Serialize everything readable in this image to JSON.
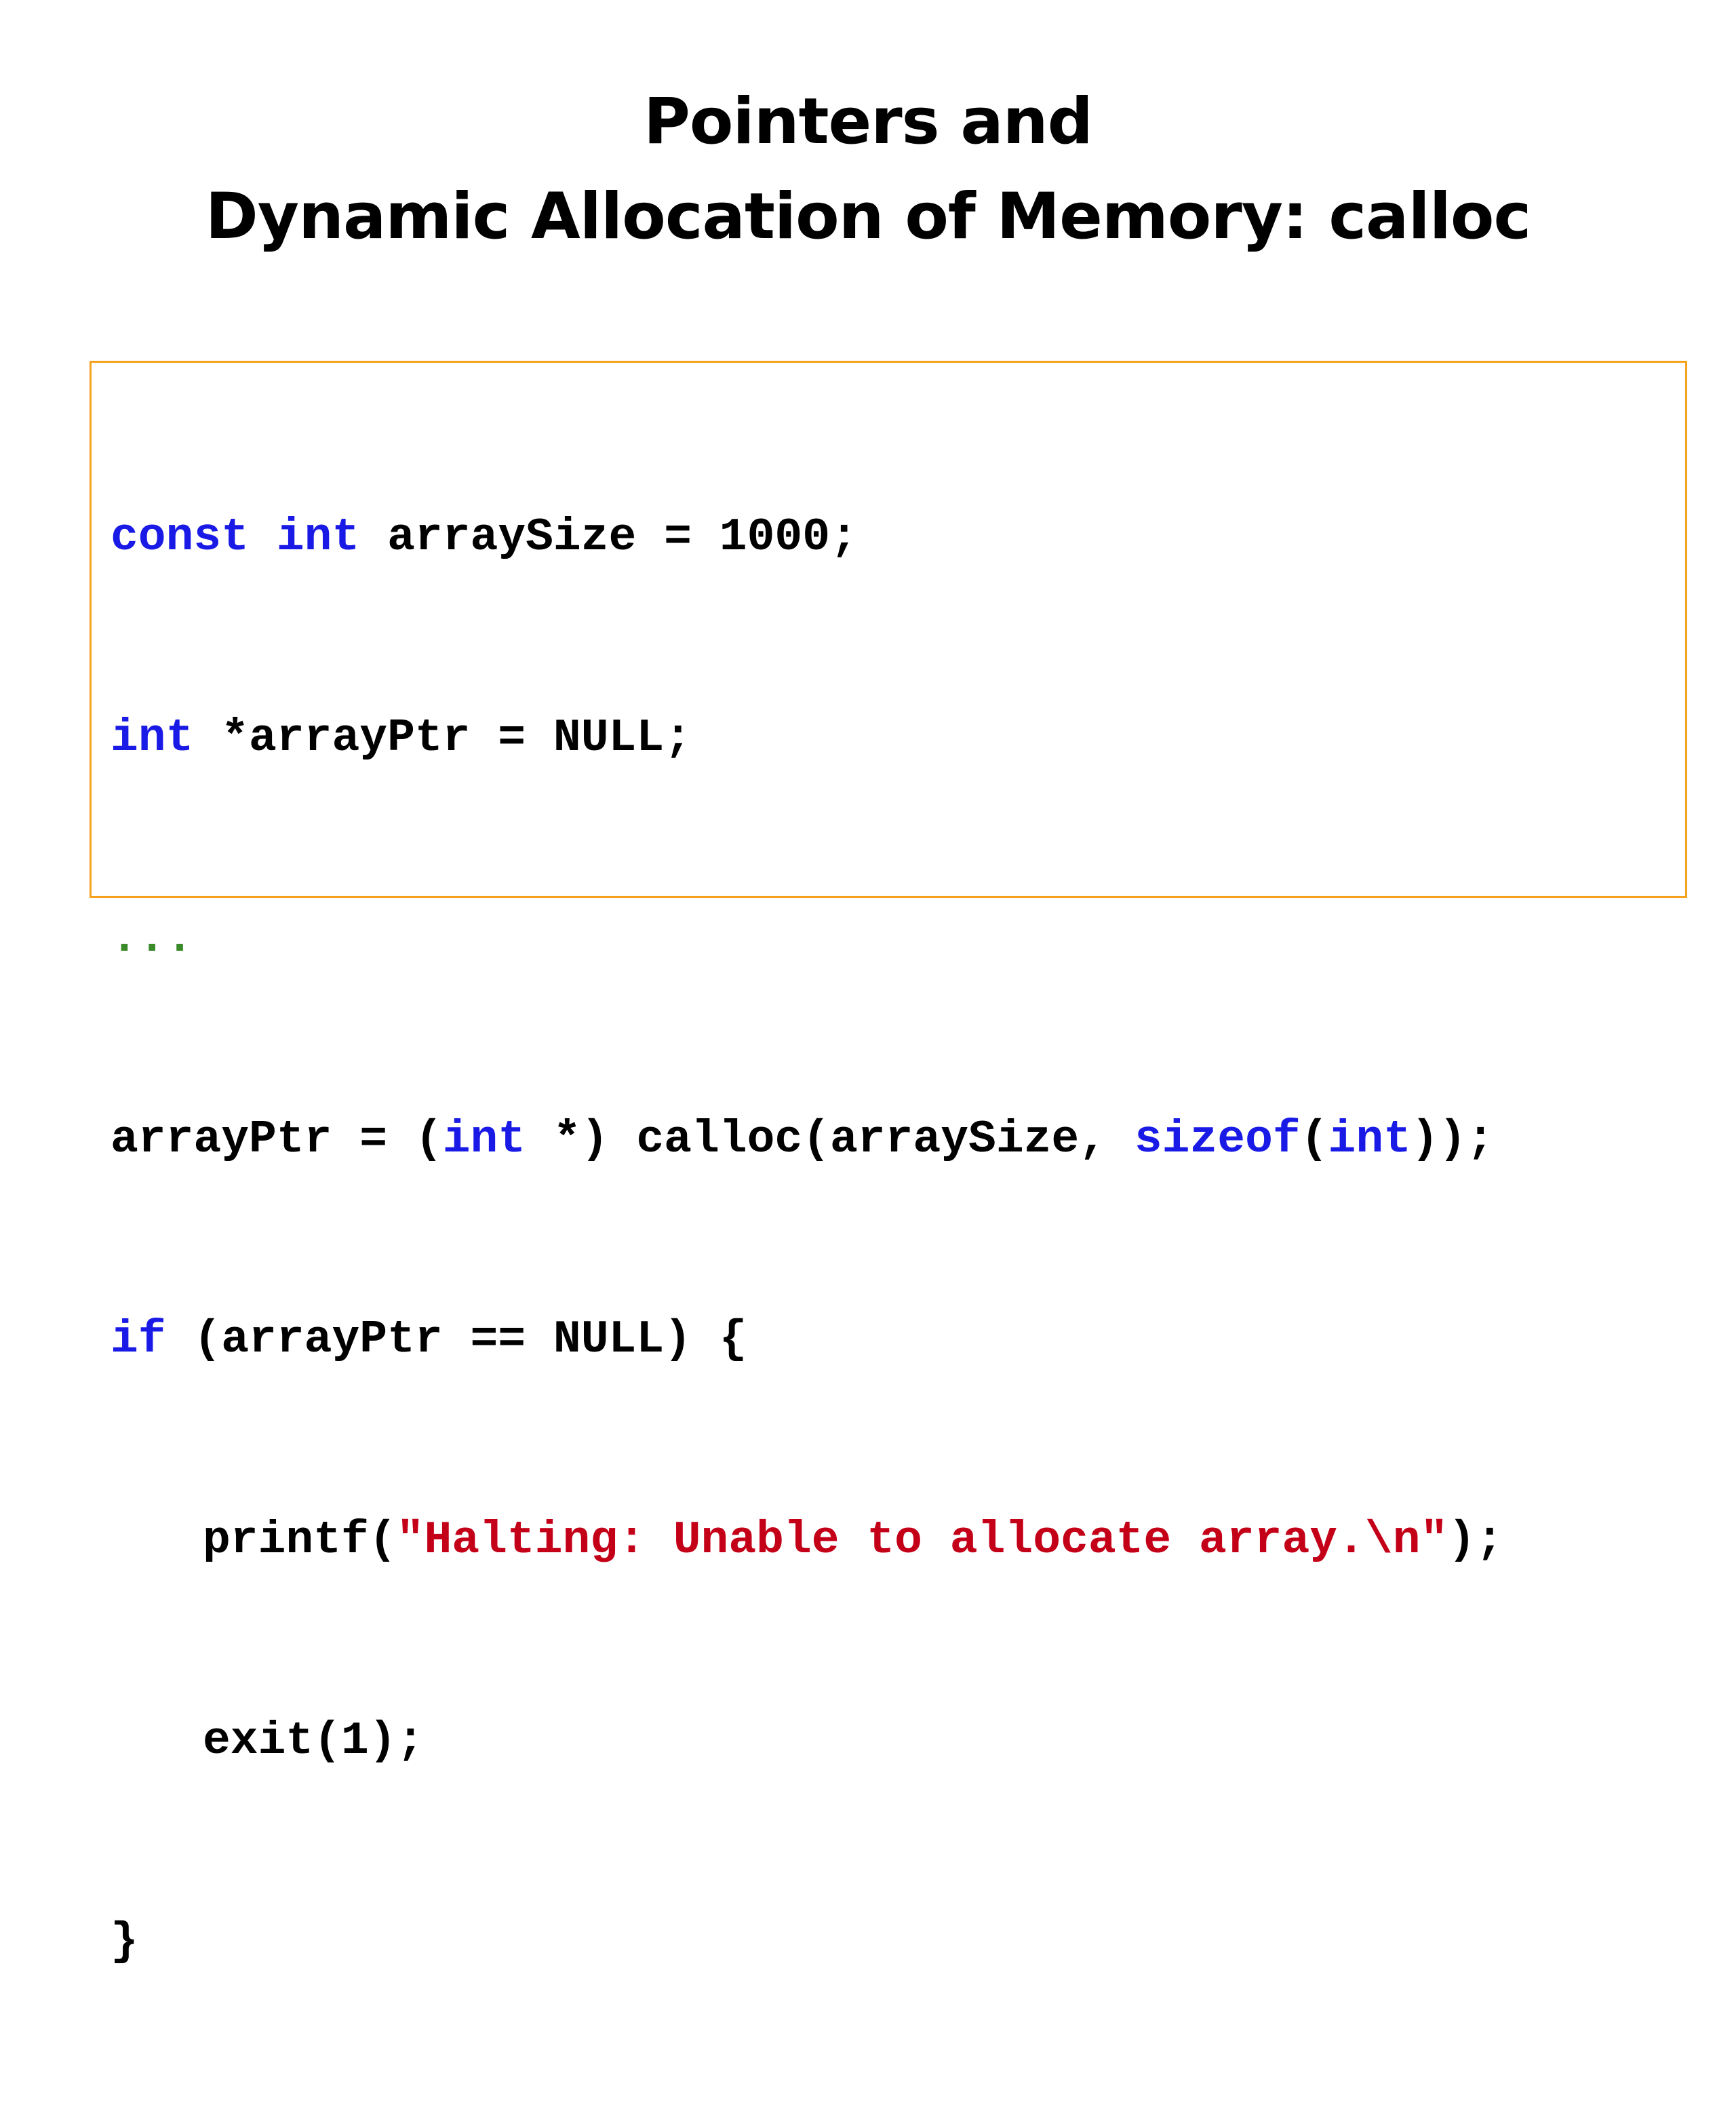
{
  "slide": {
    "title_line1": "Pointers and",
    "title_line2": "Dynamic Allocation of Memory: calloc"
  },
  "colors": {
    "keyword": "#1a1ae6",
    "string": "#c40018",
    "ellipsis": "#3a8a2a",
    "box_border": "#f5a31f"
  },
  "code": {
    "line1": {
      "kw1": "const",
      "kw2": "int",
      "rest": " arraySize = 1000;"
    },
    "line2": {
      "kw": "int",
      "rest": " *arrayPtr = NULL;"
    },
    "line3": {
      "ellipsis": "..."
    },
    "line4": {
      "pre": "arrayPtr = (",
      "kw1": "int",
      "mid": " *) calloc(arraySize, ",
      "kw2": "sizeof",
      "paren": "(",
      "kw3": "int",
      "end": "));"
    },
    "line5": {
      "kw": "if",
      "rest": " (arrayPtr == NULL) {"
    },
    "line6": {
      "pre": "printf(",
      "str": "\"Halting: Unable to allocate array.\\n\"",
      "end": ");"
    },
    "line7": {
      "text": "exit(1);"
    },
    "line8": {
      "text": "}"
    }
  }
}
